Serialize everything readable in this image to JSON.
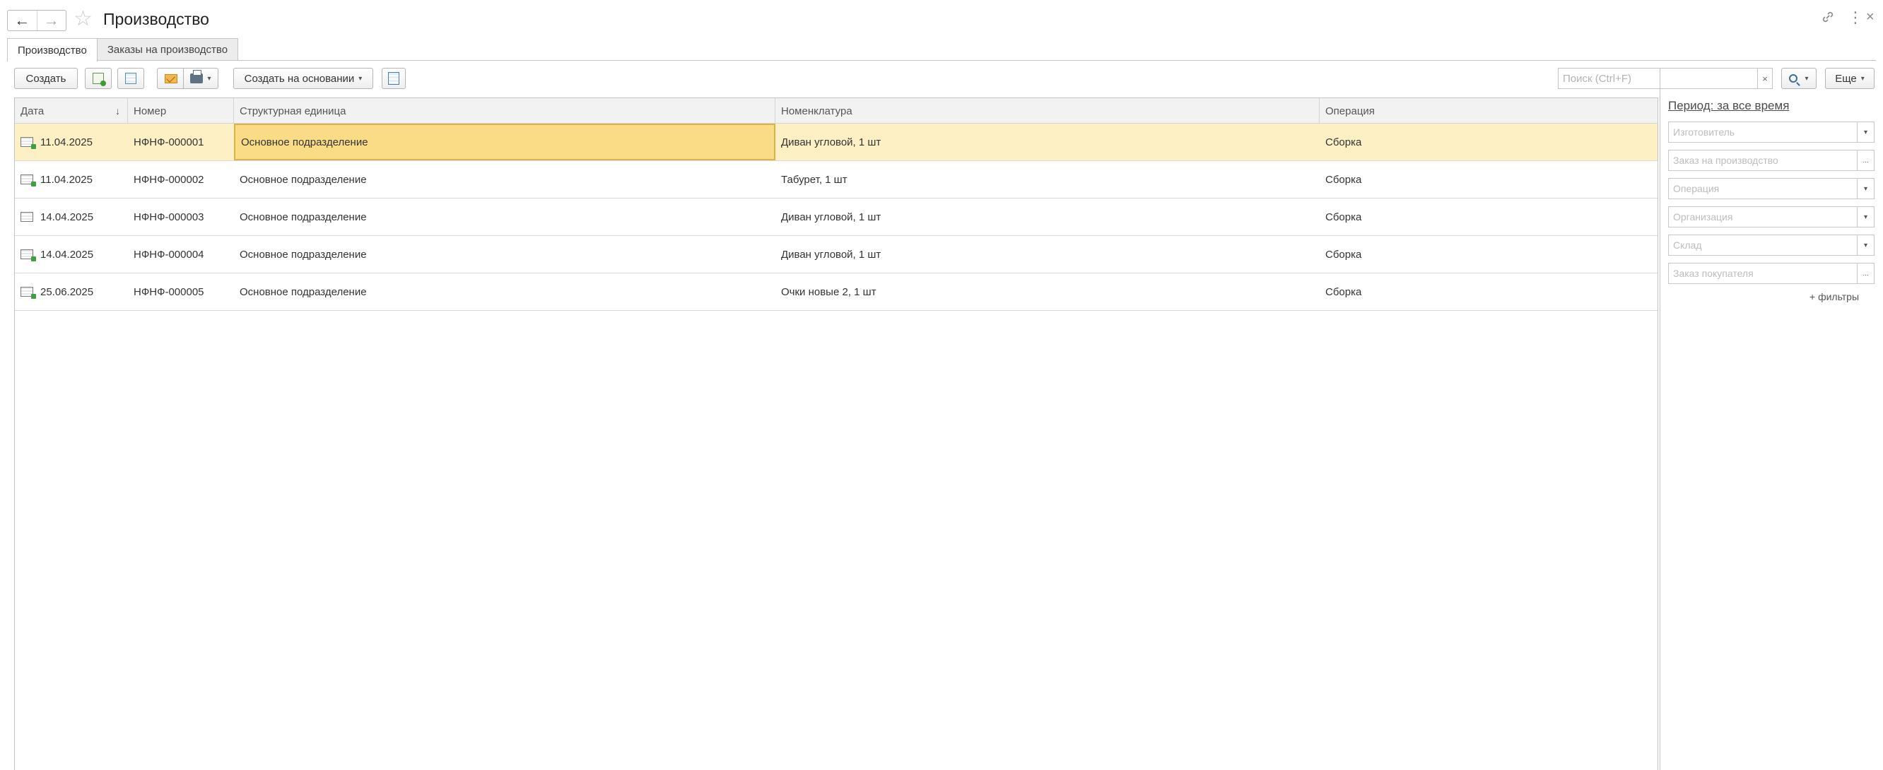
{
  "window": {
    "title": "Производство",
    "icons": {
      "back": "arrow-left-icon",
      "forward": "arrow-right-icon",
      "favorite": "star-icon",
      "link": "link-icon",
      "menu": "more-vert-icon",
      "close": "close-icon"
    }
  },
  "tabs": [
    {
      "label": "Производство",
      "active": true
    },
    {
      "label": "Заказы на производство",
      "active": false
    }
  ],
  "toolbar": {
    "create_label": "Создать",
    "create_based_label": "Создать на основании",
    "more_label": "Еще",
    "search_placeholder": "Поиск (Ctrl+F)",
    "clear_glyph": "×",
    "caret": "▾",
    "icons": [
      "copy-icon",
      "table-icon",
      "mail-icon",
      "print-icon",
      "report-icon",
      "search-icon"
    ]
  },
  "table": {
    "columns": [
      "Дата",
      "Номер",
      "Структурная единица",
      "Номенклатура",
      "Операция"
    ],
    "sort_indicator": "↓",
    "rows": [
      {
        "date": "11.04.2025",
        "number": "НФНФ-000001",
        "unit": "Основное подразделение",
        "item": "Диван угловой, 1 шт",
        "operation": "Сборка",
        "posted": true,
        "selected": true
      },
      {
        "date": "11.04.2025",
        "number": "НФНФ-000002",
        "unit": "Основное подразделение",
        "item": "Табурет, 1 шт",
        "operation": "Сборка",
        "posted": true,
        "selected": false
      },
      {
        "date": "14.04.2025",
        "number": "НФНФ-000003",
        "unit": "Основное подразделение",
        "item": "Диван угловой, 1 шт",
        "operation": "Сборка",
        "posted": false,
        "selected": false
      },
      {
        "date": "14.04.2025",
        "number": "НФНФ-000004",
        "unit": "Основное подразделение",
        "item": "Диван угловой, 1 шт",
        "operation": "Сборка",
        "posted": true,
        "selected": false
      },
      {
        "date": "25.06.2025",
        "number": "НФНФ-000005",
        "unit": "Основное подразделение",
        "item": "Очки новые 2, 1 шт",
        "operation": "Сборка",
        "posted": true,
        "selected": false
      }
    ]
  },
  "filters": {
    "period_label": "Период: за все время",
    "fields": [
      {
        "placeholder": "Изготовитель",
        "button": "▾"
      },
      {
        "placeholder": "Заказ на производство",
        "button": "..."
      },
      {
        "placeholder": "Операция",
        "button": "▾"
      },
      {
        "placeholder": "Организация",
        "button": "▾"
      },
      {
        "placeholder": "Склад",
        "button": "▾"
      },
      {
        "placeholder": "Заказ покупателя",
        "button": "..."
      }
    ],
    "add_filters_label": "+ фильтры"
  },
  "colors": {
    "selected_row": "#fcf0c4",
    "focused_cell": "#f9dc85",
    "focus_border": "#dcb246",
    "header_bg": "#f2f2f2"
  }
}
